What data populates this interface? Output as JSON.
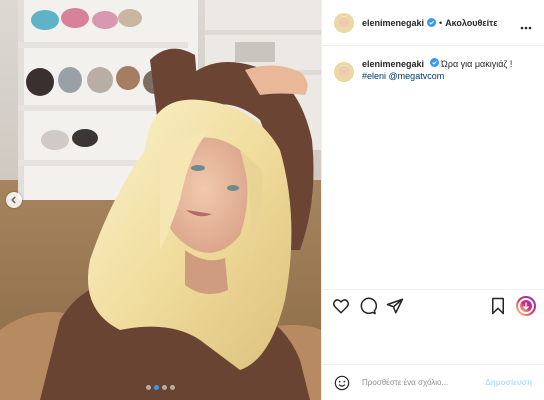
{
  "header": {
    "username": "elenimenegaki",
    "separator": "•",
    "follow_label": "Ακολουθείτε",
    "more_icon": "more-dots-icon"
  },
  "caption": {
    "username": "elenimenegaki",
    "text": " Ώρα για μακιγιάζ !",
    "hashtag": "#eleni",
    "mention": "@megatvcom"
  },
  "comment": {
    "placeholder": "Προσθέστε ένα σχόλιο...",
    "post_label": "Δημοσίευση"
  },
  "carousel": {
    "total": 4,
    "active": 2
  },
  "colors": {
    "verified": "#3897f0",
    "link": "#00376b",
    "post_disabled": "#b2dffc",
    "active_dot": "#3897f0"
  },
  "icons": [
    "heart-icon",
    "comment-icon",
    "share-icon",
    "bookmark-icon",
    "reels-icon",
    "emoji-icon",
    "chevron-left-icon",
    "verified-icon"
  ]
}
